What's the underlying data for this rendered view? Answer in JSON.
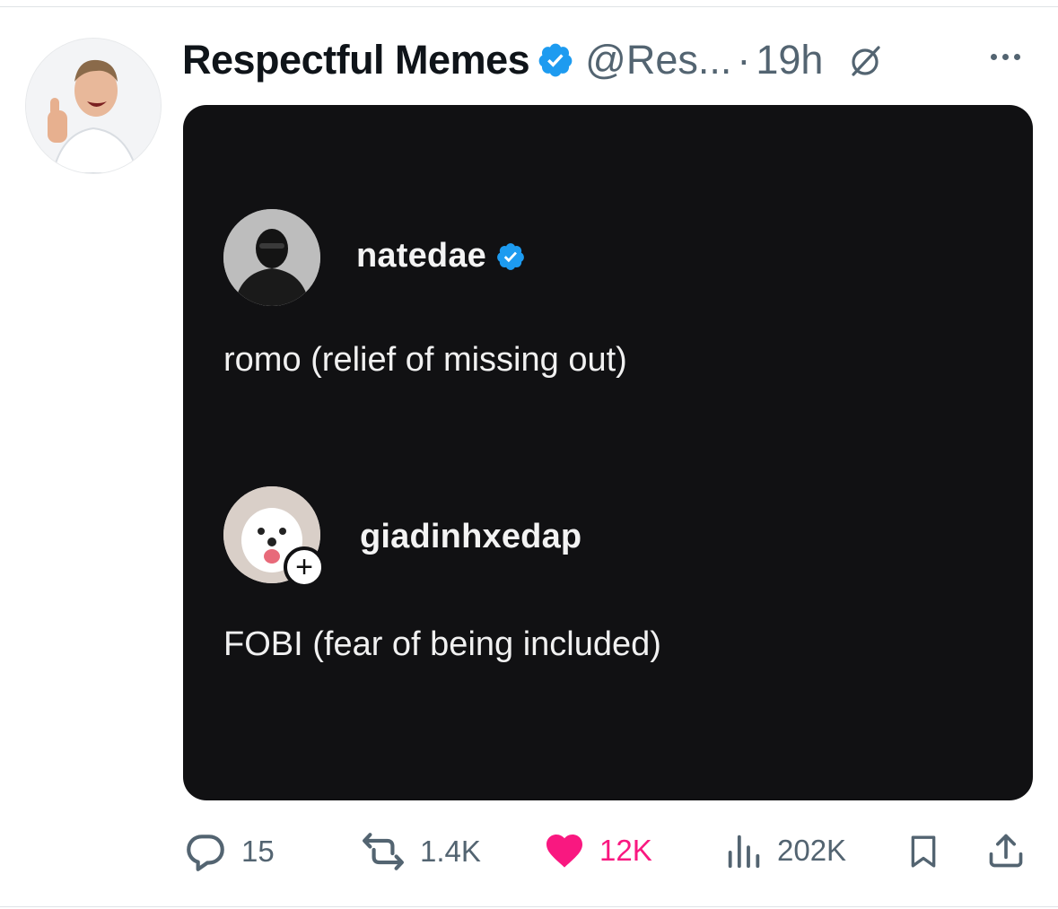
{
  "tweet": {
    "display_name": "Respectful Memes",
    "handle": "@Res...",
    "separator": "·",
    "time": "19h"
  },
  "media": {
    "posts": [
      {
        "username": "natedae",
        "verified": true,
        "text": "romo (relief of missing out)"
      },
      {
        "username": "giadinhxedap",
        "verified": false,
        "follow_badge": "+",
        "text": "FOBI (fear of being included)"
      }
    ]
  },
  "actions": {
    "replies": "15",
    "reposts": "1.4K",
    "likes": "12K",
    "views": "202K"
  },
  "colors": {
    "verified_blue": "#1d9bf0",
    "like_pink": "#f91880",
    "muted_gray": "#536471",
    "media_bg": "#111113"
  },
  "icons": [
    "grok-icon",
    "more-icon",
    "reply-icon",
    "repost-icon",
    "heart-icon",
    "views-icon",
    "bookmark-icon",
    "share-icon",
    "verified-badge-icon"
  ]
}
